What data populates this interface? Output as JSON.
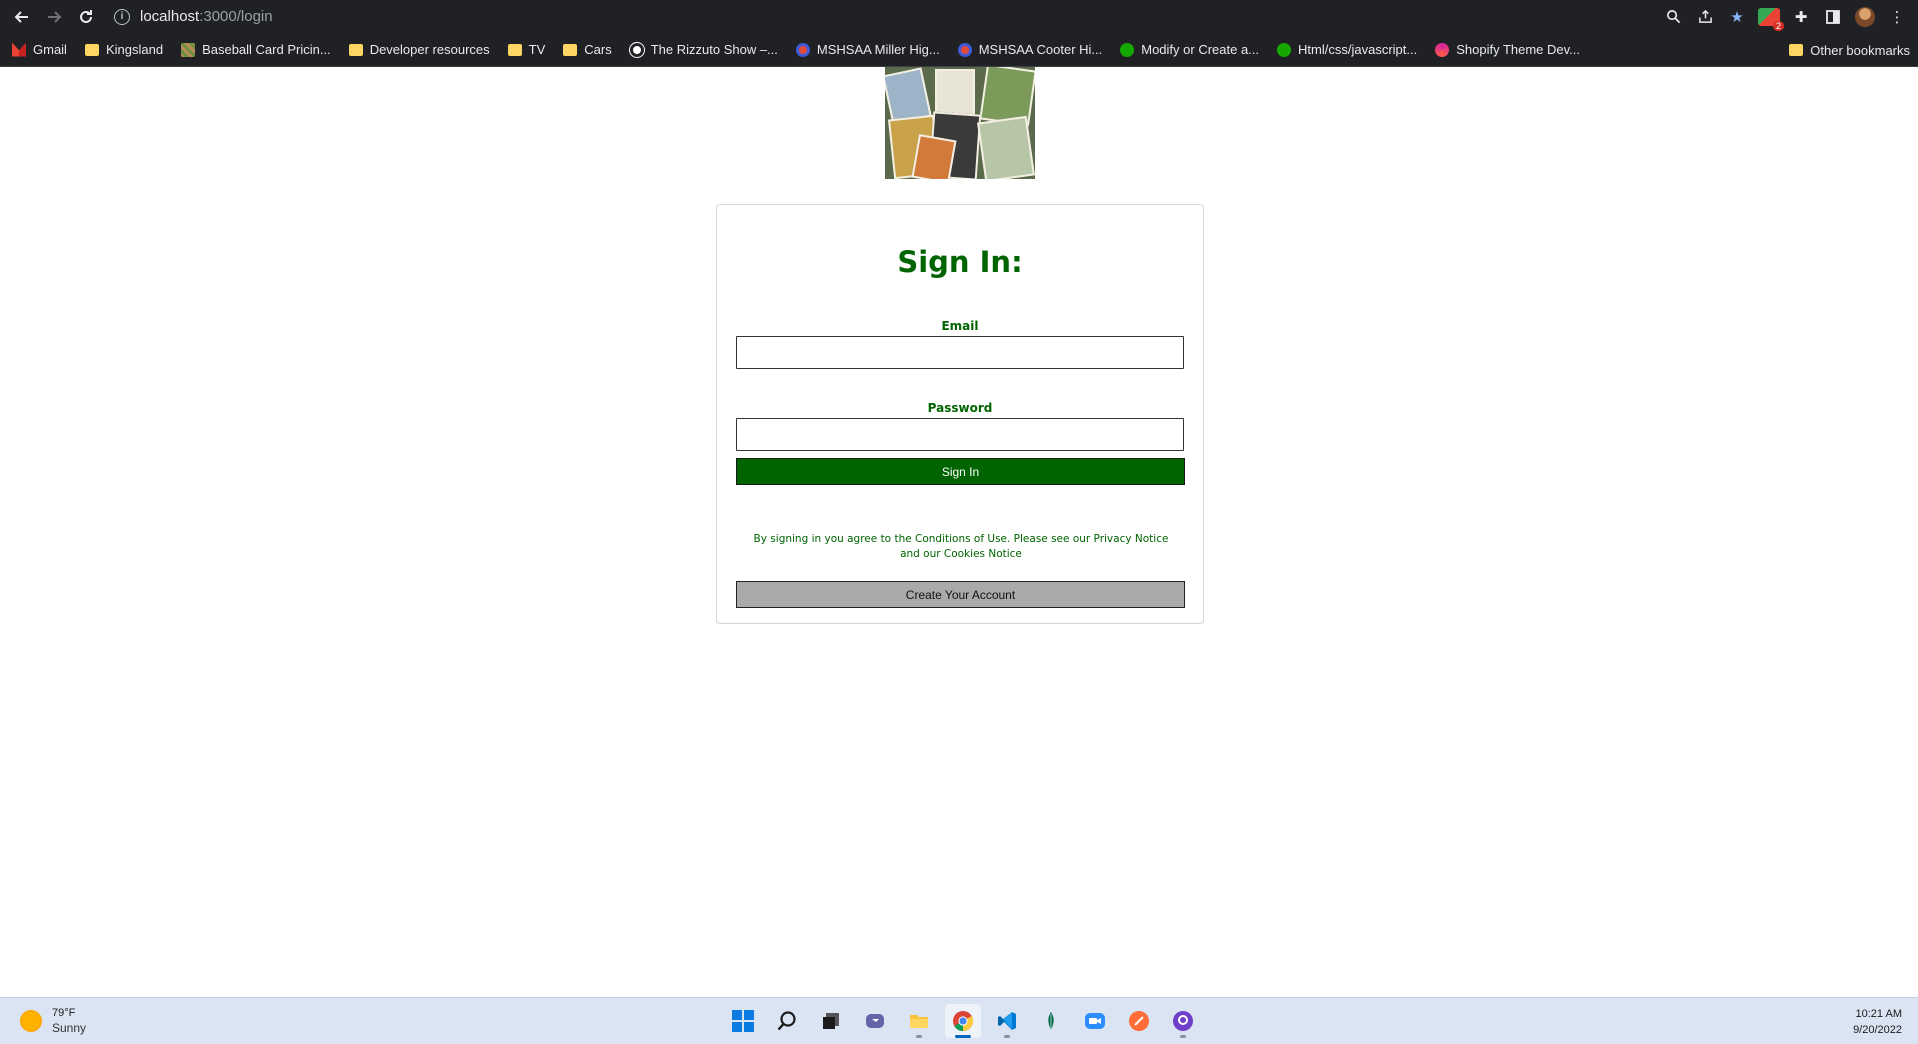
{
  "browser": {
    "url_host": "localhost",
    "url_path": ":3000/login",
    "bookmarks": [
      {
        "label": "Gmail",
        "icon": "gmail-icon"
      },
      {
        "label": "Kingsland",
        "icon": "folder-icon"
      },
      {
        "label": "Baseball Card Pricin...",
        "icon": "card-icon"
      },
      {
        "label": "Developer resources",
        "icon": "folder-icon"
      },
      {
        "label": "TV",
        "icon": "folder-icon"
      },
      {
        "label": "Cars",
        "icon": "folder-icon"
      },
      {
        "label": "The Rizzuto Show –...",
        "icon": "circle-icon"
      },
      {
        "label": "MSHSAA Miller Hig...",
        "icon": "mshsaa-icon"
      },
      {
        "label": "MSHSAA Cooter Hi...",
        "icon": "mshsaa-icon"
      },
      {
        "label": "Modify or Create a...",
        "icon": "upwork-icon"
      },
      {
        "label": "Html/css/javascript...",
        "icon": "upwork-icon"
      },
      {
        "label": "Shopify Theme Dev...",
        "icon": "shopify-icon"
      }
    ],
    "other_bookmarks": "Other bookmarks",
    "extension_badge": "2"
  },
  "login": {
    "title": "Sign In:",
    "email_label": "Email",
    "email_value": "",
    "password_label": "Password",
    "password_value": "",
    "signin_button": "Sign In",
    "legal_text": "By signing in you agree to the Conditions of Use. Please see our Privacy Notice and our Cookies Notice",
    "create_button": "Create Your Account"
  },
  "colors": {
    "brand_green": "#006400",
    "create_button_gray": "#a9a9a9"
  },
  "taskbar": {
    "temperature": "79°F",
    "condition": "Sunny",
    "time": "10:21 AM",
    "date": "9/20/2022",
    "apps": [
      "windows-start-icon",
      "search-icon",
      "task-view-icon",
      "teams-icon",
      "file-explorer-icon",
      "chrome-icon",
      "vscode-icon",
      "mongodb-icon",
      "zoom-icon",
      "postman-icon",
      "github-desktop-icon"
    ]
  }
}
